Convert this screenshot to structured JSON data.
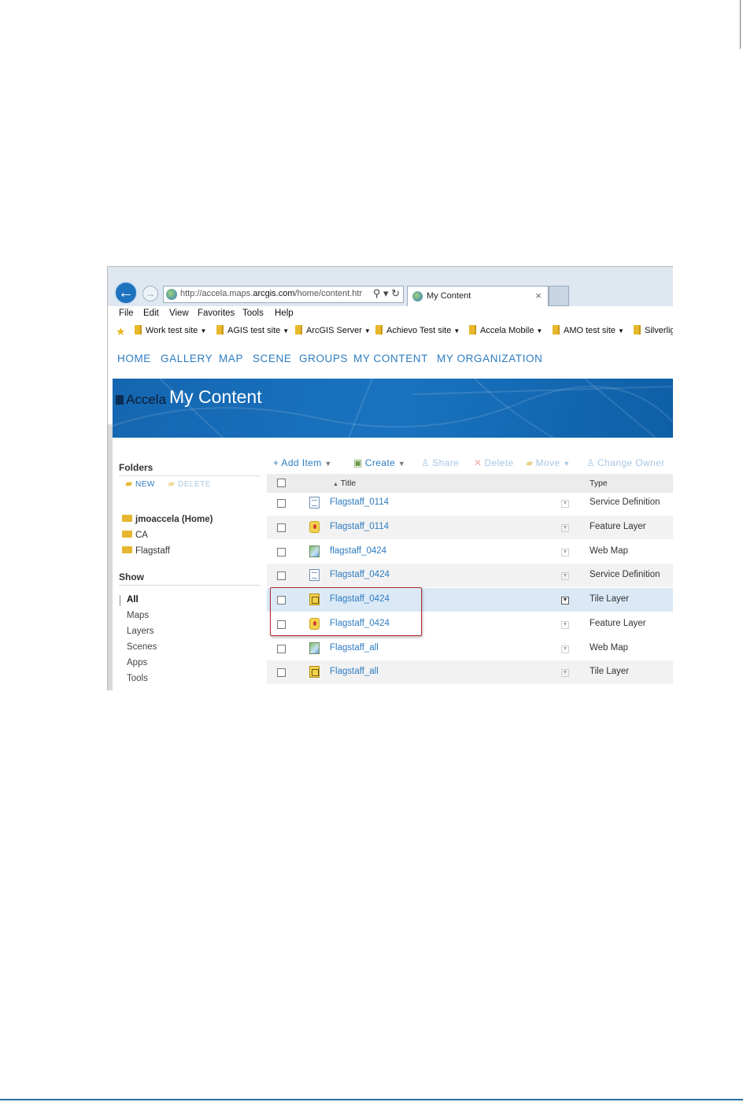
{
  "browser": {
    "url_prefix": "http://accela.maps.",
    "url_domain": "arcgis.com",
    "url_suffix": "/home/content.htr",
    "url_controls": "⚲ ▾ ↻",
    "tab_title": "My Content",
    "tab_close": "×",
    "menu": [
      "File",
      "Edit",
      "View",
      "Favorites",
      "Tools",
      "Help"
    ],
    "favorites": [
      "Work test site",
      "AGIS test site",
      "ArcGIS Server",
      "Achievo Test site",
      "Accela Mobile",
      "AMO test site",
      "Silverlig"
    ]
  },
  "nav": [
    "HOME",
    "GALLERY",
    "MAP",
    "SCENE",
    "GROUPS",
    "MY CONTENT",
    "MY ORGANIZATION"
  ],
  "banner": {
    "logo": "Accela",
    "title": "My Content"
  },
  "sidebar": {
    "folders_heading": "Folders",
    "new_label": "NEW",
    "delete_label": "DELETE",
    "folders": [
      "jmoaccela (Home)",
      "CA",
      "Flagstaff"
    ],
    "show_heading": "Show",
    "show_items": [
      "All",
      "Maps",
      "Layers",
      "Scenes",
      "Apps",
      "Tools"
    ]
  },
  "toolbar": {
    "add_item": "Add Item",
    "create": "Create",
    "share": "Share",
    "delete": "Delete",
    "move": "Move",
    "change_owner": "Change Owner"
  },
  "table": {
    "title_header": "Title",
    "type_header": "Type",
    "rows": [
      {
        "title": "Flagstaff_0114",
        "type": "Service Definition"
      },
      {
        "title": "Flagstaff_0114",
        "type": "Feature Layer"
      },
      {
        "title": "flagstaff_0424",
        "type": "Web Map"
      },
      {
        "title": "Flagstaff_0424",
        "type": "Service Definition"
      },
      {
        "title": "Flagstaff_0424",
        "type": "Tile Layer"
      },
      {
        "title": "Flagstaff_0424",
        "type": "Feature Layer"
      },
      {
        "title": "Flagstaff_all",
        "type": "Web Map"
      },
      {
        "title": "Flagstaff_all",
        "type": "Tile Layer"
      }
    ]
  },
  "colors": {
    "link": "#2d7cc1",
    "banner": "#1a73bf",
    "highlight": "#b22a2a"
  }
}
